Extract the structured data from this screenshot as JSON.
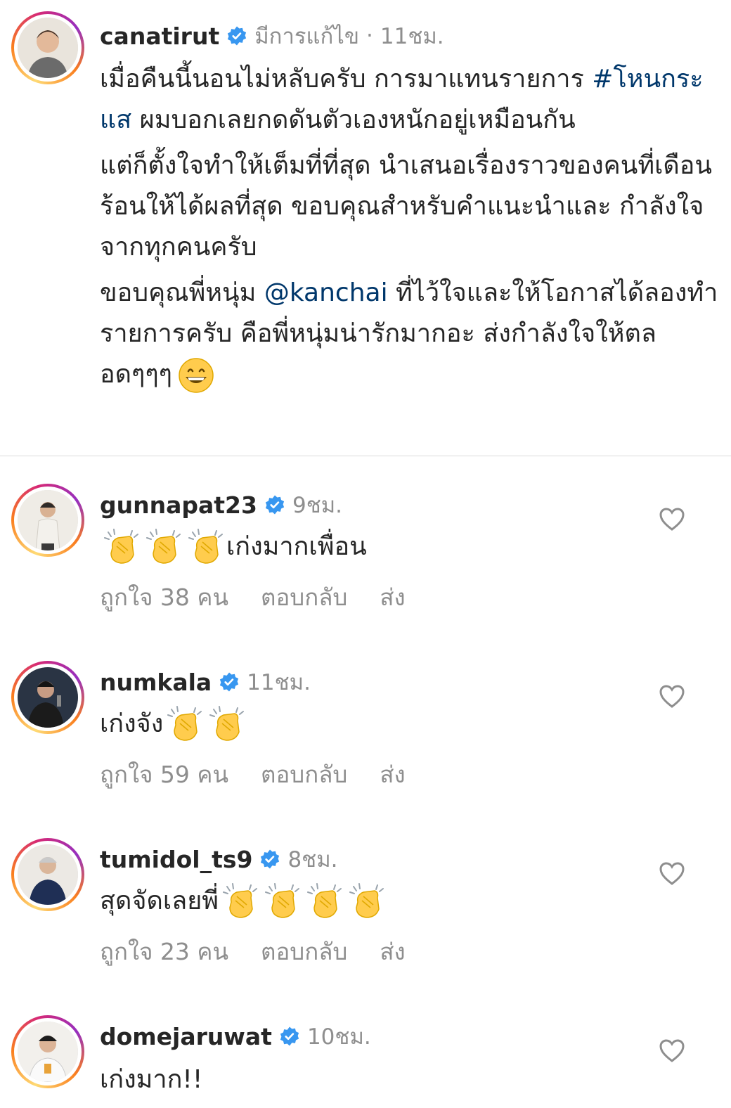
{
  "post": {
    "username": "canatirut",
    "edited_label": "มีการแก้ไข",
    "time": "11ชม.",
    "caption": {
      "p1_a": "เมื่อคืนนี้นอนไม่หลับครับ การมาแทนรายการ",
      "p1_hashtag": "#โหนกระแส",
      "p1_b": " ผมบอกเลยกดดันตัวเองหนักอยู่เหมือนกัน",
      "p2": "แต่ก็ตั้งใจทำให้เต็มที่ที่สุด นำเสนอเรื่องราวของคนที่เดือนร้อนให้ได้ผลที่สุด ขอบคุณสำหรับคำแนะนำและ กำลังใจจากทุกคนครับ",
      "p3_a": "ขอบคุณพี่หนุ่ม ",
      "p3_mention": "@kanchai",
      "p3_b": " ที่ไว้ใจและให้โอกาสได้ลองทำรายการครับ คือพี่หนุ่มน่ารักมากอะ ส่งกำลังใจให้ตลอดๆๆๆ",
      "emoji": "grinning-face-emoji"
    }
  },
  "actions": {
    "reply": "ตอบกลับ",
    "send": "ส่ง"
  },
  "comments": [
    {
      "username": "gunnapat23",
      "time": "9ชม.",
      "text": "เก่งมากเพื่อน",
      "likes": "ถูกใจ 38 คน"
    },
    {
      "username": "numkala",
      "time": "11ชม.",
      "text": "เก่งจัง",
      "likes": "ถูกใจ 59 คน"
    },
    {
      "username": "tumidol_ts9",
      "time": "8ชม.",
      "text": "สุดจัดเลยพี่",
      "likes": "ถูกใจ 23 คน"
    },
    {
      "username": "domejaruwat",
      "time": "10ชม.",
      "text": "เก่งมาก!!"
    }
  ],
  "colors": {
    "link": "#00376b",
    "verified": "#3897f0",
    "muted": "#8e8e8e"
  }
}
